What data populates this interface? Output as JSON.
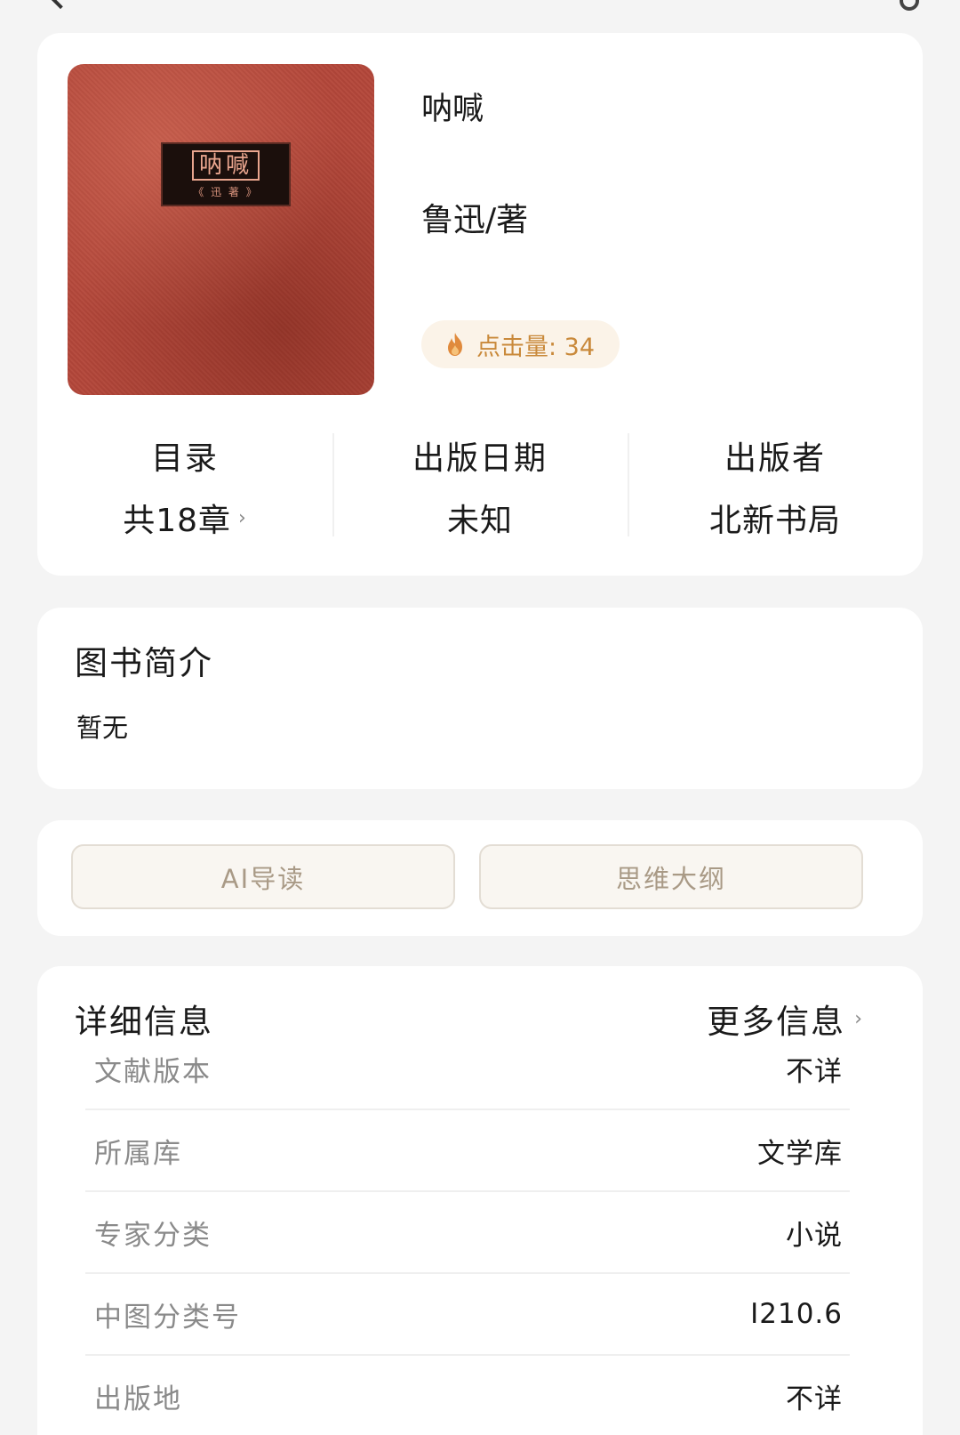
{
  "book": {
    "title": "呐喊",
    "author": "鲁迅/著",
    "cover_title": "呐喊",
    "cover_subtitle": "《 迅 著 》",
    "click_count_label": "点击量: 34"
  },
  "stats": [
    {
      "label": "目录",
      "value": "共18章"
    },
    {
      "label": "出版日期",
      "value": "未知"
    },
    {
      "label": "出版者",
      "value": "北新书局"
    }
  ],
  "intro": {
    "title": "图书简介",
    "text": "暂无"
  },
  "actions": {
    "ai_label": "AI导读",
    "mindmap_label": "思维大纲"
  },
  "details": {
    "title": "详细信息",
    "more_label": "更多信息",
    "rows": [
      {
        "key": "文献版本",
        "value": "不详"
      },
      {
        "key": "所属库",
        "value": "文学库"
      },
      {
        "key": "专家分类",
        "value": "小说"
      },
      {
        "key": "中图分类号",
        "value": "I210.6"
      },
      {
        "key": "出版地",
        "value": "不详"
      }
    ]
  },
  "colors": {
    "accent_gold": "#c9893a",
    "cover_red": "#b4473a",
    "button_text": "#a99a86"
  },
  "icons": {
    "flame": "flame-icon",
    "chevron": "chevron-right-icon"
  }
}
